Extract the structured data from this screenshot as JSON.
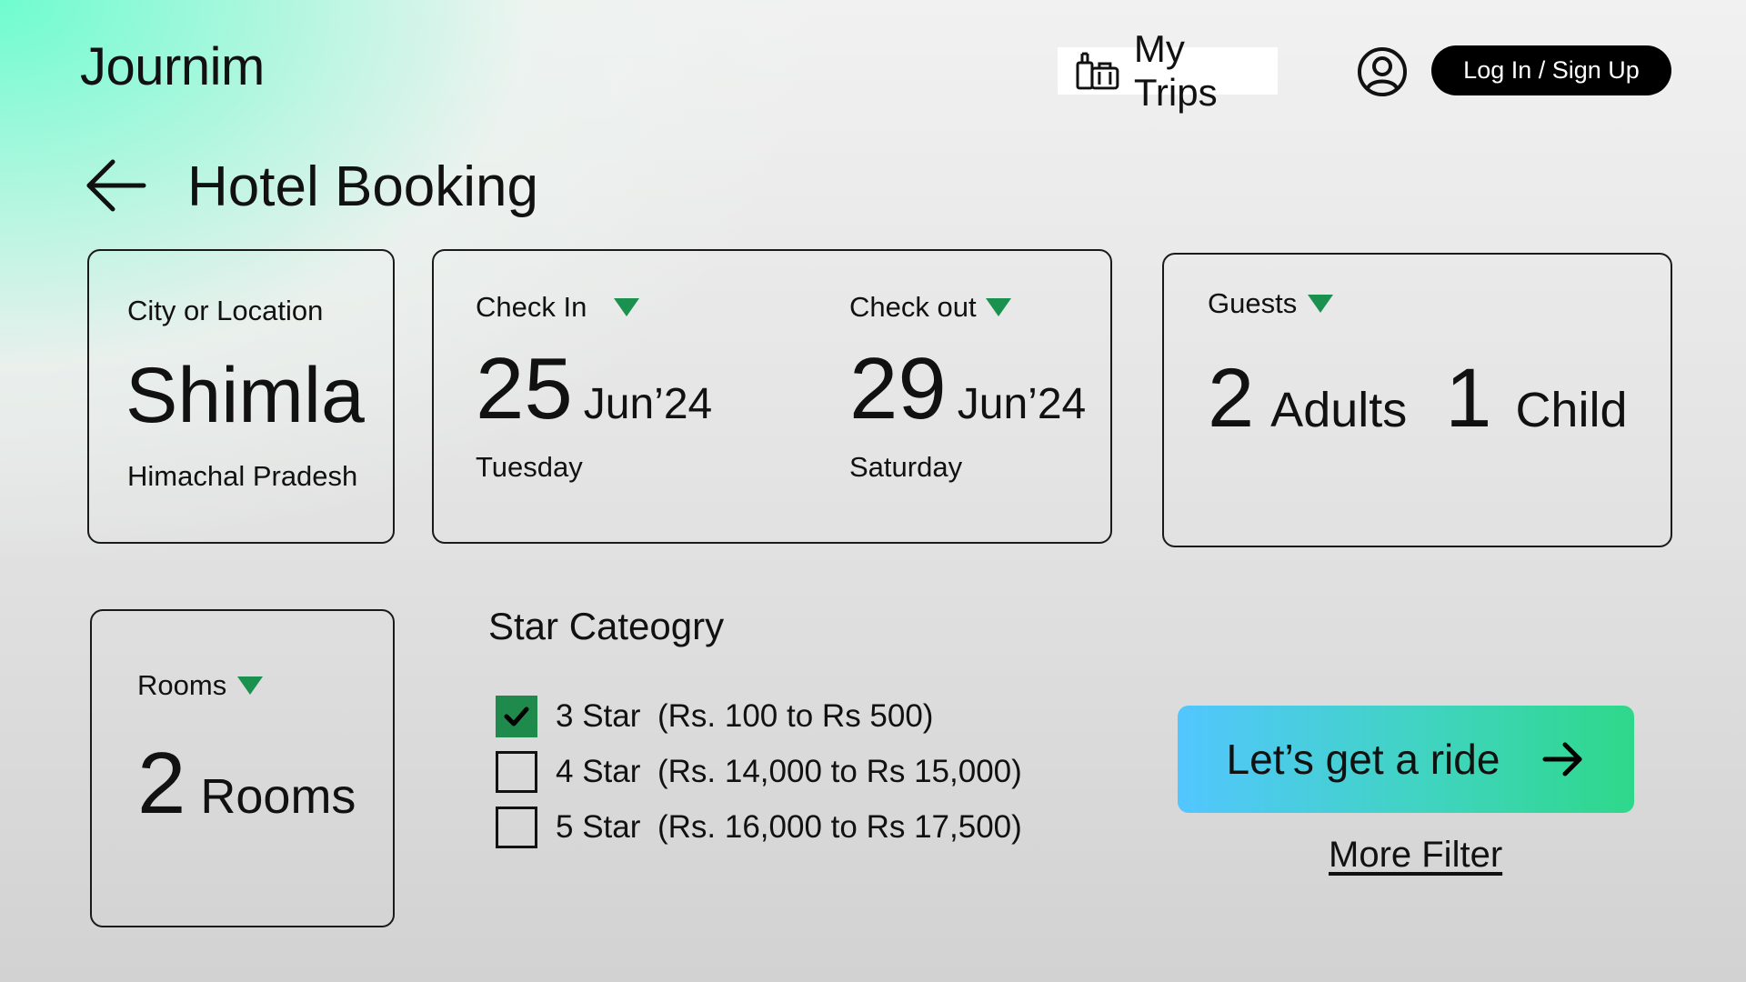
{
  "header": {
    "logo": "Journim",
    "my_trips_label": "My Trips",
    "login_label": "Log In / Sign Up"
  },
  "page_title": "Hotel Booking",
  "location": {
    "label": "City or Location",
    "city": "Shimla",
    "state": "Himachal Pradesh"
  },
  "dates": {
    "check_in": {
      "label": "Check In",
      "day": "25",
      "month_year": "Jun’24",
      "weekday": "Tuesday"
    },
    "check_out": {
      "label": "Check out",
      "day": "29",
      "month_year": "Jun’24",
      "weekday": "Saturday"
    }
  },
  "guests": {
    "label": "Guests",
    "adults_count": "2",
    "adults_label": "Adults",
    "child_count": "1",
    "child_label": "Child"
  },
  "rooms": {
    "label": "Rooms",
    "count": "2",
    "unit": "Rooms"
  },
  "star_category": {
    "title": "Star Cateogry",
    "options": [
      {
        "name": "3 Star",
        "range": "(Rs. 100 to Rs 500)",
        "checked": true
      },
      {
        "name": "4 Star",
        "range": "(Rs. 14,000 to Rs 15,000)",
        "checked": false
      },
      {
        "name": "5 Star",
        "range": "(Rs. 16,000 to Rs 17,500)",
        "checked": false
      }
    ]
  },
  "cta": {
    "label": "Let’s get a ride",
    "more_filter": "More Filter"
  },
  "colors": {
    "accent_green": "#1e8a4c",
    "dropdown_green": "#1b9150",
    "cta_start": "#52c6ff",
    "cta_end": "#2ed88a"
  },
  "icons": {
    "trips": "luggage-icon",
    "user": "user-circle-icon",
    "back": "arrow-left-icon",
    "cta": "arrow-right-icon",
    "dropdown": "triangle-down-icon",
    "check": "checkmark-icon"
  }
}
